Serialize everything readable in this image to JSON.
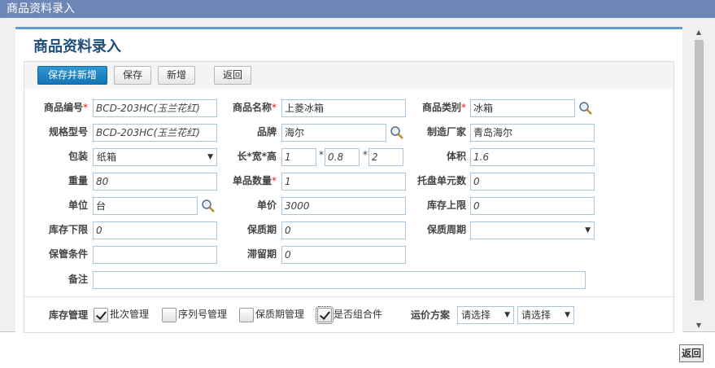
{
  "window": {
    "title": "商品资料录入"
  },
  "page": {
    "heading": "商品资料录入"
  },
  "toolbar": {
    "save_new": "保存并新增",
    "save": "保存",
    "add": "新增",
    "back": "返回"
  },
  "fields": {
    "code": {
      "label": "商品编号",
      "value": "BCD-203HC(玉兰花红)"
    },
    "name": {
      "label": "商品名称",
      "value": "上菱冰箱"
    },
    "category": {
      "label": "商品类别",
      "value": "冰箱"
    },
    "spec": {
      "label": "规格型号",
      "value": "BCD-203HC(玉兰花红)"
    },
    "brand": {
      "label": "品牌",
      "value": "海尔"
    },
    "maker": {
      "label": "制造厂家",
      "value": "青岛海尔"
    },
    "pack": {
      "label": "包装",
      "value": "纸箱"
    },
    "lwh": {
      "label": "长*宽*高",
      "l": "1",
      "w": "0.8",
      "h": "2",
      "sep": "*"
    },
    "volume": {
      "label": "体积",
      "value": "1.6"
    },
    "weight": {
      "label": "重量",
      "value": "80"
    },
    "unit_qty": {
      "label": "单品数量",
      "value": "1"
    },
    "pallet": {
      "label": "托盘单元数",
      "value": "0"
    },
    "unit": {
      "label": "单位",
      "value": "台"
    },
    "price": {
      "label": "单价",
      "value": "3000"
    },
    "stock_max": {
      "label": "库存上限",
      "value": "0"
    },
    "stock_min": {
      "label": "库存下限",
      "value": "0"
    },
    "shelf_life": {
      "label": "保质期",
      "value": "0"
    },
    "shelf_cycle": {
      "label": "保质周期",
      "value": ""
    },
    "storage": {
      "label": "保管条件",
      "value": ""
    },
    "stay": {
      "label": "滞留期",
      "value": "0"
    },
    "remark": {
      "label": "备注",
      "value": ""
    }
  },
  "inventory": {
    "label": "库存管理",
    "options": [
      {
        "label": "批次管理",
        "checked": true
      },
      {
        "label": "序列号管理",
        "checked": false
      },
      {
        "label": "保质期管理",
        "checked": false
      },
      {
        "label": "是否组合件",
        "checked": true
      }
    ]
  },
  "freight": {
    "label": "运价方案",
    "select1": "请选择",
    "select2": "请选择"
  },
  "footer": {
    "back": "返回"
  },
  "icons": {
    "lookup": "magnifier-icon",
    "dropdown": "chevron-down-icon"
  }
}
